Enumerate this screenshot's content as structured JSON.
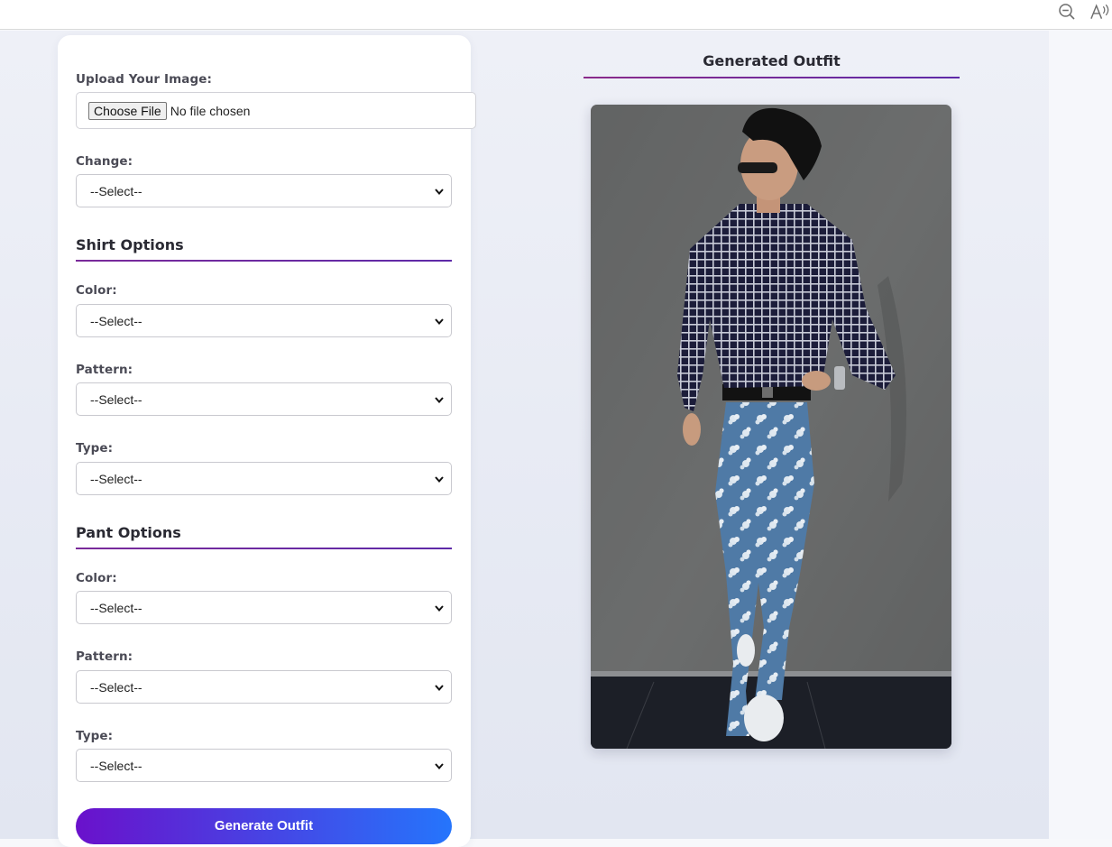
{
  "form": {
    "upload_label": "Upload Your Image:",
    "choose_file_label": "Choose File",
    "no_file_text": "No file chosen",
    "change_label": "Change:",
    "change_value": "--Select--",
    "shirt_section_title": "Shirt Options",
    "shirt": {
      "color_label": "Color:",
      "color_value": "--Select--",
      "pattern_label": "Pattern:",
      "pattern_value": "--Select--",
      "type_label": "Type:",
      "type_value": "--Select--"
    },
    "pant_section_title": "Pant Options",
    "pant": {
      "color_label": "Color:",
      "color_value": "--Select--",
      "pattern_label": "Pattern:",
      "pattern_value": "--Select--",
      "type_label": "Type:",
      "type_value": "--Select--"
    },
    "generate_label": "Generate Outfit"
  },
  "output": {
    "title": "Generated Outfit"
  },
  "browser": {
    "icons": [
      "zoom-out-icon",
      "read-aloud-icon"
    ]
  },
  "colors": {
    "accent_start": "#6a11cb",
    "accent_end": "#2575fc",
    "section_rule": "#7a2a9a"
  }
}
